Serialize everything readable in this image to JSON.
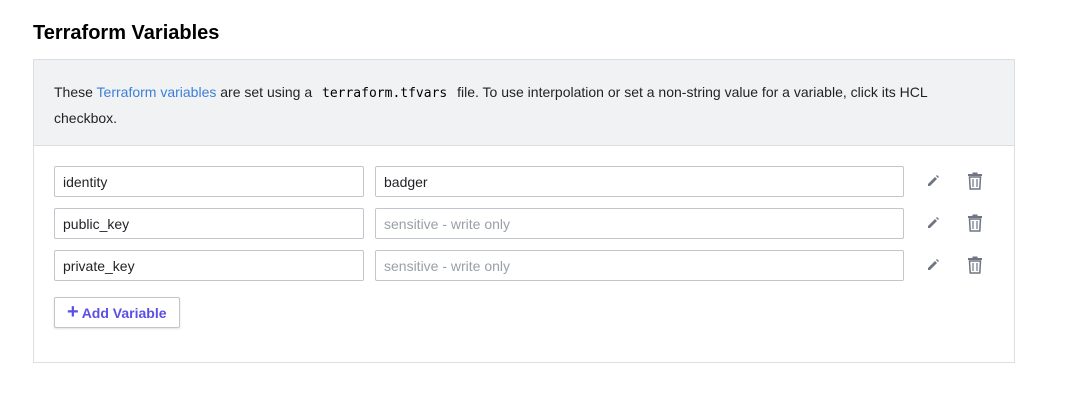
{
  "section": {
    "title": "Terraform Variables"
  },
  "info": {
    "prefix": "These ",
    "link_text": "Terraform variables",
    "middle": " are set using a ",
    "code": "terraform.tfvars",
    "suffix": " file. To use interpolation or set a non-string value for a variable, click its HCL checkbox."
  },
  "variables": [
    {
      "key": "identity",
      "value": "badger",
      "placeholder": ""
    },
    {
      "key": "public_key",
      "value": "",
      "placeholder": "sensitive - write only"
    },
    {
      "key": "private_key",
      "value": "",
      "placeholder": "sensitive - write only"
    }
  ],
  "add_button": {
    "icon": "+",
    "label": "Add Variable"
  },
  "icons": {
    "edit": "pencil-icon",
    "delete": "trash-icon"
  },
  "colors": {
    "link": "#3d7fd6",
    "accent": "#5c4ee5",
    "info_bg": "#f1f2f3"
  }
}
